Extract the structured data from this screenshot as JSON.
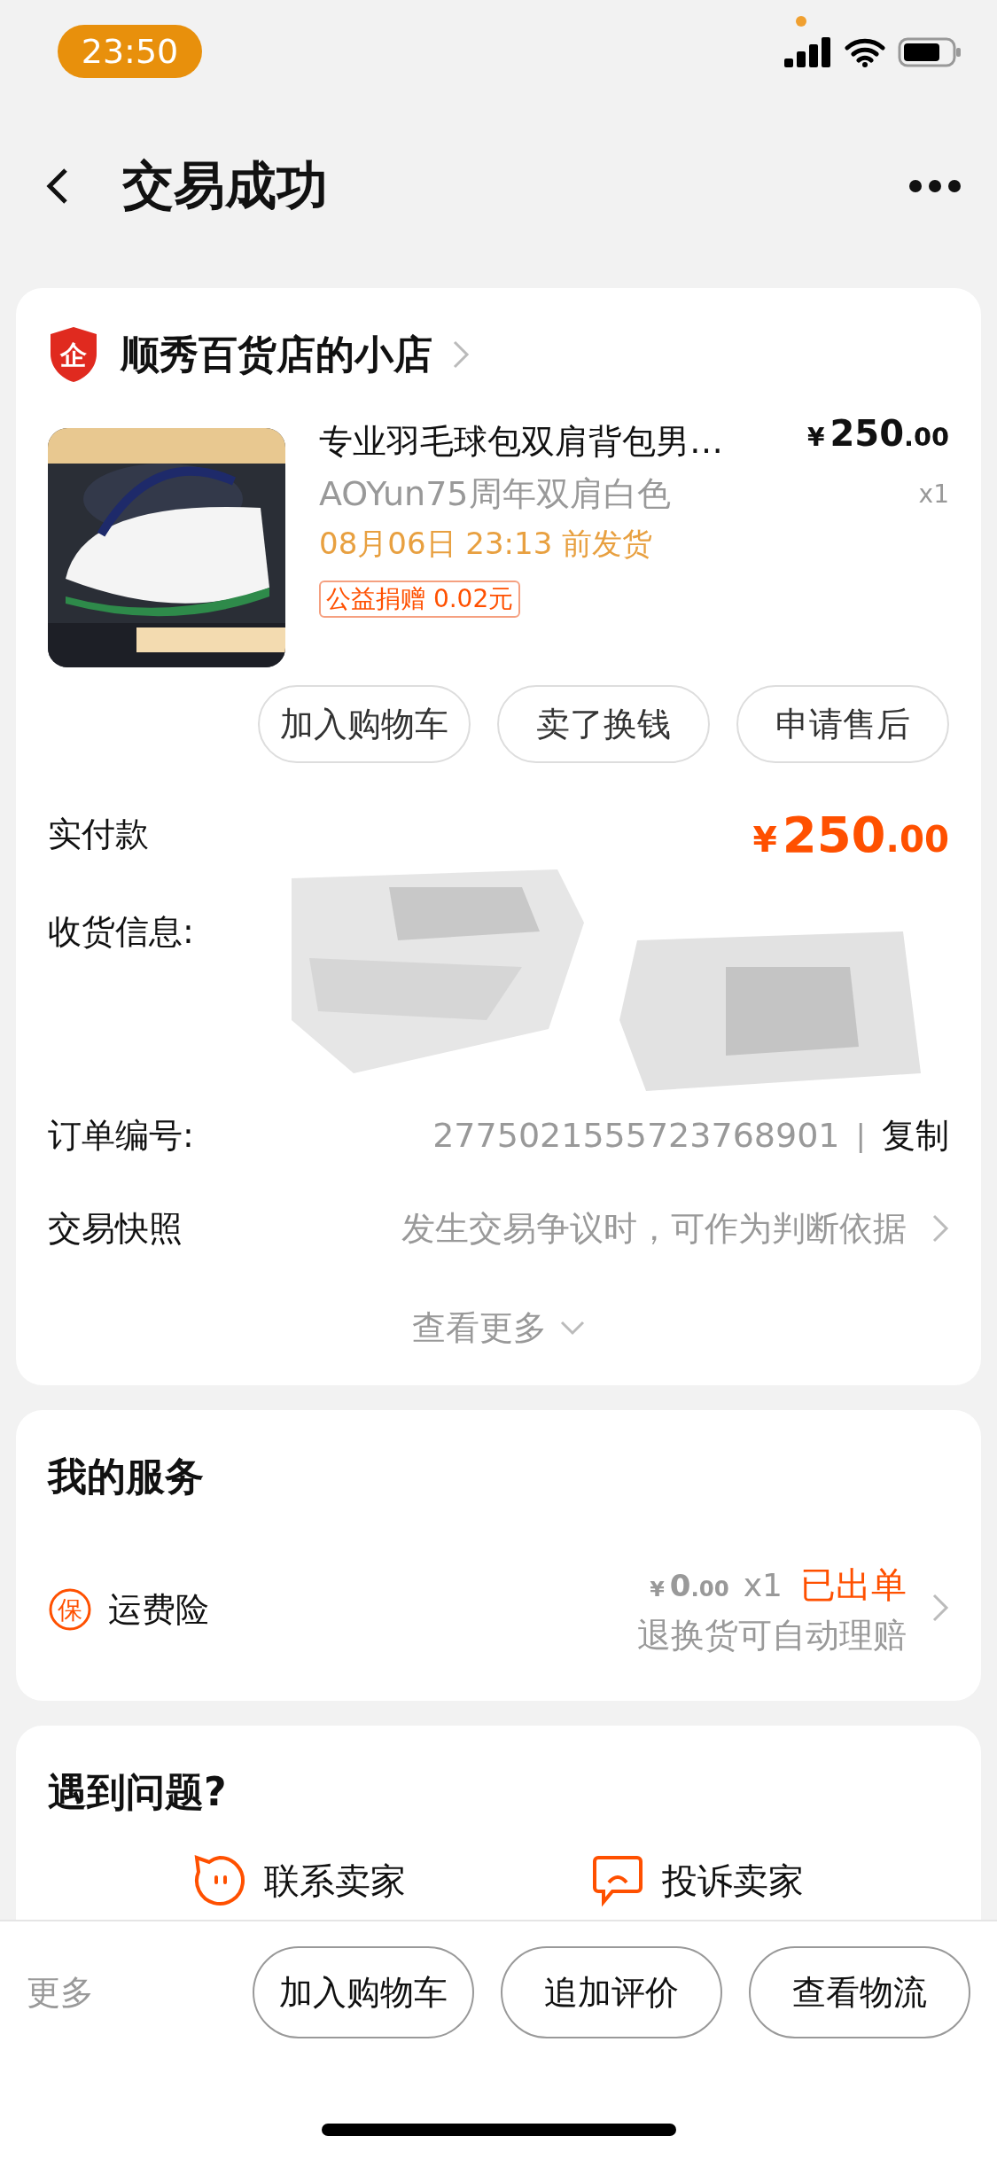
{
  "status_bar": {
    "time": "23:50"
  },
  "nav": {
    "title": "交易成功"
  },
  "shop": {
    "badge": "企",
    "name": "顺秀百货店的小店"
  },
  "product": {
    "title": "专业羽毛球包双肩背包男…",
    "price": {
      "currency": "¥",
      "integer": "250",
      "decimal": ".00"
    },
    "quantity": "x1",
    "variant": "AOYun75周年双肩白色",
    "ship_by": "08月06日 23:13 前发货",
    "charity_tag": "公益捐赠 0.02元"
  },
  "product_actions": [
    "加入购物车",
    "卖了换钱",
    "申请售后"
  ],
  "payment": {
    "label": "实付款",
    "price": {
      "currency": "¥",
      "integer": "250",
      "decimal": ".00"
    }
  },
  "shipping": {
    "label": "收货信息:"
  },
  "order_number": {
    "label": "订单编号:",
    "value": "2775021555723768901",
    "separator": "|",
    "action": "复制"
  },
  "snapshot": {
    "label": "交易快照",
    "hint": "发生交易争议时，可作为判断依据"
  },
  "see_more": "查看更多",
  "services": {
    "title": "我的服务",
    "items": [
      {
        "badge": "保",
        "name": "运费险",
        "price": {
          "currency": "¥",
          "integer": "0",
          "decimal": ".00"
        },
        "quantity": "x1",
        "status": "已出单",
        "note": "退换货可自动理赔"
      }
    ]
  },
  "help": {
    "title": "遇到问题?",
    "actions": [
      {
        "kind": "contact",
        "label": "联系卖家"
      },
      {
        "kind": "complain",
        "label": "投诉卖家"
      }
    ]
  },
  "bottom_bar": {
    "more": "更多",
    "buttons": [
      "加入购物车",
      "追加评价",
      "查看物流"
    ]
  }
}
